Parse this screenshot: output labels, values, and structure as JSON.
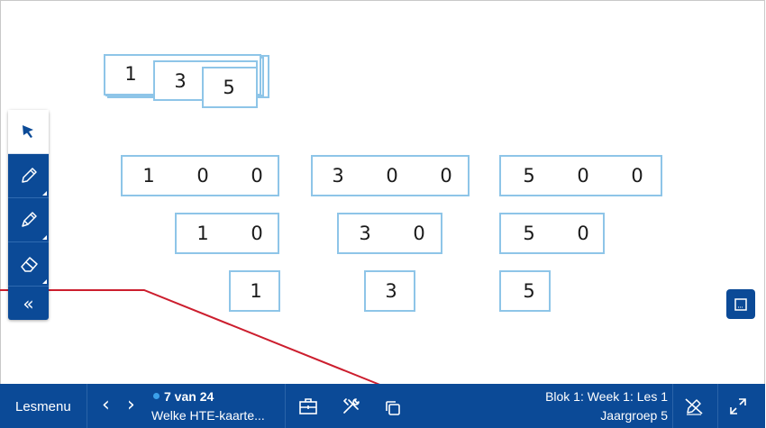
{
  "canvas": {
    "stack_cards": [
      "1",
      "3",
      "5"
    ],
    "row1": [
      [
        "1",
        "0",
        "0"
      ],
      [
        "3",
        "0",
        "0"
      ],
      [
        "5",
        "0",
        "0"
      ]
    ],
    "row2": [
      [
        "1",
        "0"
      ],
      [
        "3",
        "0"
      ],
      [
        "5",
        "0"
      ]
    ],
    "row3": [
      [
        "1"
      ],
      [
        "3"
      ],
      [
        "5"
      ]
    ]
  },
  "left_toolbar": {
    "tools": [
      "pointer-icon",
      "pencil-icon",
      "highlighter-icon",
      "eraser-icon"
    ],
    "collapse_label": "«"
  },
  "bottom_bar": {
    "menu_label": "Lesmenu",
    "prev_label": "‹",
    "next_label": "›",
    "page_counter": "7 van 24",
    "page_title": "Welke HTE-kaarte...",
    "lesson_line1": "Blok 1: Week 1: Les 1",
    "lesson_line2": "Jaargroep 5"
  },
  "colors": {
    "brand_blue": "#0b4a97",
    "card_border": "#8ec5e8",
    "annotation_red": "#cc1e2e",
    "status_dot": "#3ba0ea"
  }
}
